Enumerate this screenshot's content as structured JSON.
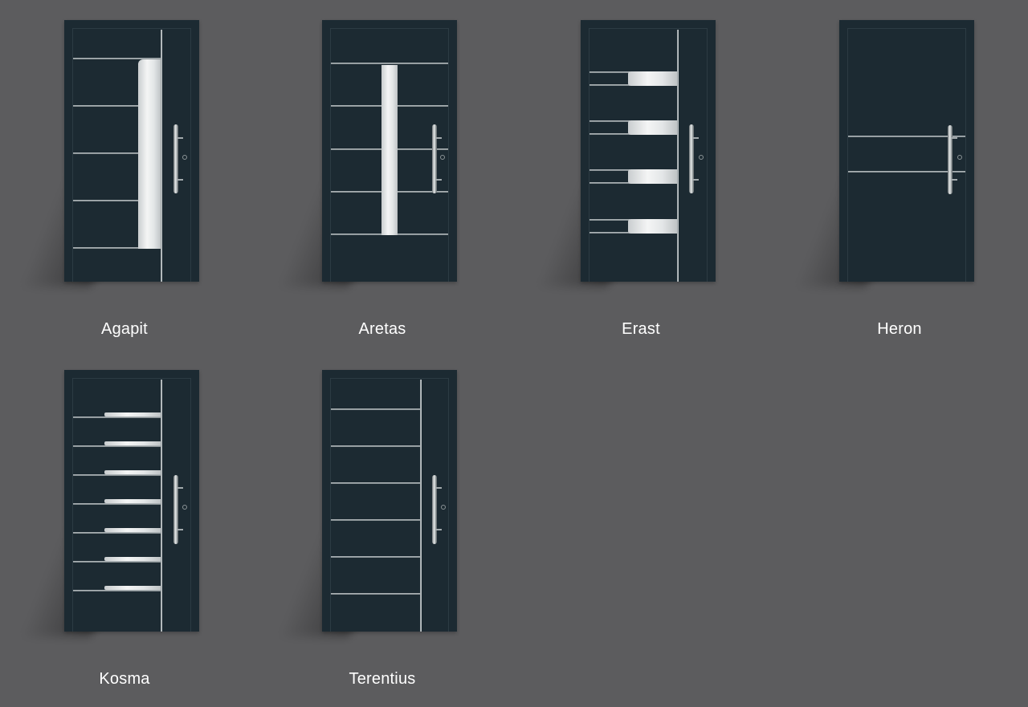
{
  "gallery": {
    "doors": [
      {
        "name": "Agapit"
      },
      {
        "name": "Aretas"
      },
      {
        "name": "Erast"
      },
      {
        "name": "Heron"
      },
      {
        "name": "Kosma"
      },
      {
        "name": "Terentius"
      }
    ]
  },
  "colors": {
    "background": "#5c5c5e",
    "door": "#1c2a32",
    "label": "#ffffff",
    "steel": "#c0c6c8"
  }
}
